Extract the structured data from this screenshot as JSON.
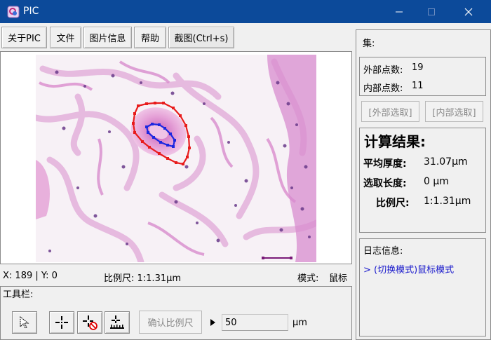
{
  "window": {
    "title": "PIC"
  },
  "menu": {
    "items": [
      {
        "label": "关于PIC"
      },
      {
        "label": "文件"
      },
      {
        "label": "图片信息"
      },
      {
        "label": "帮助"
      },
      {
        "label": "截图(Ctrl+s)"
      }
    ]
  },
  "status": {
    "coords": "X: 189 | Y: 0",
    "scale": "比例尺: 1:1.31μm",
    "mode_label": "模式:",
    "mode_value": "鼠标"
  },
  "toolbar": {
    "label": "工具栏:",
    "tools": [
      {
        "icon": "cursor-arrow-icon"
      },
      {
        "icon": "crosshair-point-icon"
      },
      {
        "icon": "crosshair-no-icon"
      },
      {
        "icon": "ruler-measure-icon"
      }
    ],
    "confirm_label": "确认比例尺",
    "scale_value": "50",
    "unit": "μm"
  },
  "side": {
    "set_label": "集:",
    "outer_count_label": "外部点数:",
    "outer_count": "19",
    "inner_count_label": "内部点数:",
    "inner_count": "11",
    "outer_select_label": "[外部选取]",
    "inner_select_label": "[内部选取]"
  },
  "results": {
    "title": "计算结果:",
    "avg_thickness_label": "平均厚度:",
    "avg_thickness": "31.07μm",
    "selection_length_label": "选取长度:",
    "selection_length": "0 μm",
    "scale_label": "比例尺:",
    "scale_value": "1:1.31μm"
  },
  "log": {
    "title": "日志信息:",
    "entries": [
      "> (切换模式)鼠标模式"
    ]
  },
  "colors": {
    "titlebar": "#0c4a9a",
    "outer_contour": "#e81c1c",
    "inner_contour": "#1c28e0",
    "scale_bar": "#7a1a78",
    "log_text": "#1a1acc"
  }
}
